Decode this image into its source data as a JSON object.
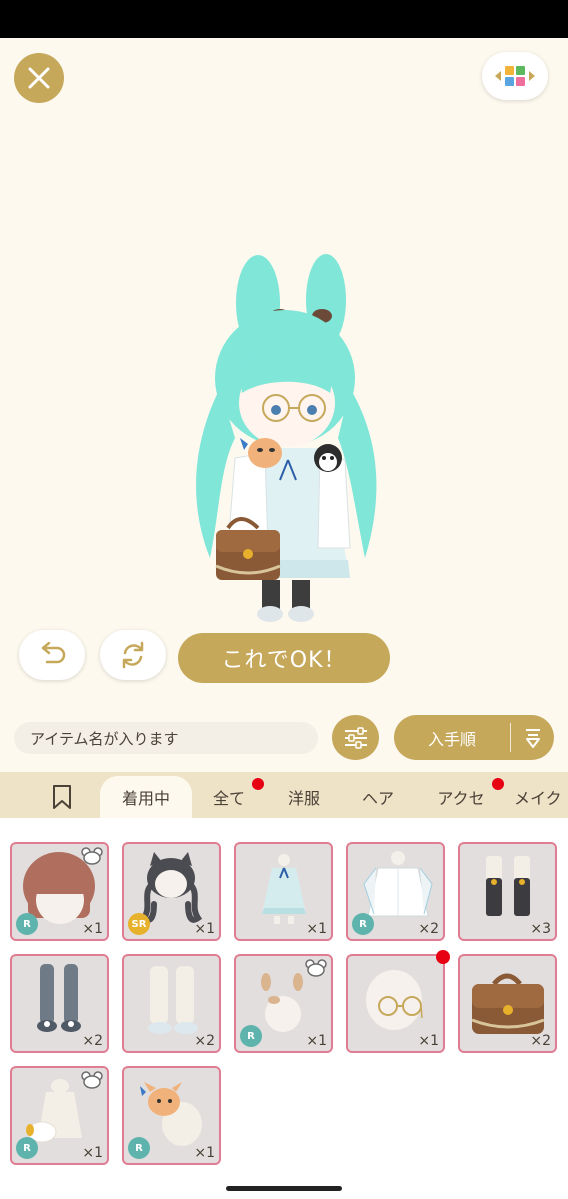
{
  "actions": {
    "ok_label": "これでOK！"
  },
  "search": {
    "placeholder": "アイテム名が入ります"
  },
  "sort": {
    "label": "入手順"
  },
  "tabs": [
    {
      "label": "着用中",
      "active": true,
      "new": false
    },
    {
      "label": "全て",
      "active": false,
      "new": true
    },
    {
      "label": "洋服",
      "active": false,
      "new": false
    },
    {
      "label": "ヘア",
      "active": false,
      "new": false
    },
    {
      "label": "アクセ",
      "active": false,
      "new": true
    },
    {
      "label": "メイク",
      "active": false,
      "new": false
    }
  ],
  "items": [
    {
      "name": "brown-bob-hair",
      "count": "×1",
      "rarity": "R",
      "bear": true,
      "new": false
    },
    {
      "name": "cat-ear-twintail-hair",
      "count": "×1",
      "rarity": "SR",
      "bear": false,
      "new": false
    },
    {
      "name": "mint-dress",
      "count": "×1",
      "rarity": "",
      "bear": false,
      "new": false
    },
    {
      "name": "white-jacket",
      "count": "×2",
      "rarity": "R",
      "bear": false,
      "new": false
    },
    {
      "name": "black-socks",
      "count": "×3",
      "rarity": "",
      "bear": false,
      "new": false
    },
    {
      "name": "grey-tights",
      "count": "×2",
      "rarity": "",
      "bear": false,
      "new": false
    },
    {
      "name": "white-boots",
      "count": "×2",
      "rarity": "",
      "bear": false,
      "new": false
    },
    {
      "name": "antler-accessory",
      "count": "×1",
      "rarity": "R",
      "bear": true,
      "new": false
    },
    {
      "name": "round-glasses",
      "count": "×1",
      "rarity": "",
      "bear": false,
      "new": true
    },
    {
      "name": "brown-satchel",
      "count": "×2",
      "rarity": "",
      "bear": false,
      "new": false
    },
    {
      "name": "white-muff",
      "count": "×1",
      "rarity": "R",
      "bear": true,
      "new": false
    },
    {
      "name": "shoulder-cat-plush",
      "count": "×1",
      "rarity": "R",
      "bear": false,
      "new": false
    }
  ],
  "colors": {
    "gold": "#c6a85b",
    "background": "#fdf9ef",
    "tab_bar": "#efe3c7",
    "item_border": "#e07d93",
    "hair": "#7fe6d8",
    "notice_dot": "#e60012"
  }
}
